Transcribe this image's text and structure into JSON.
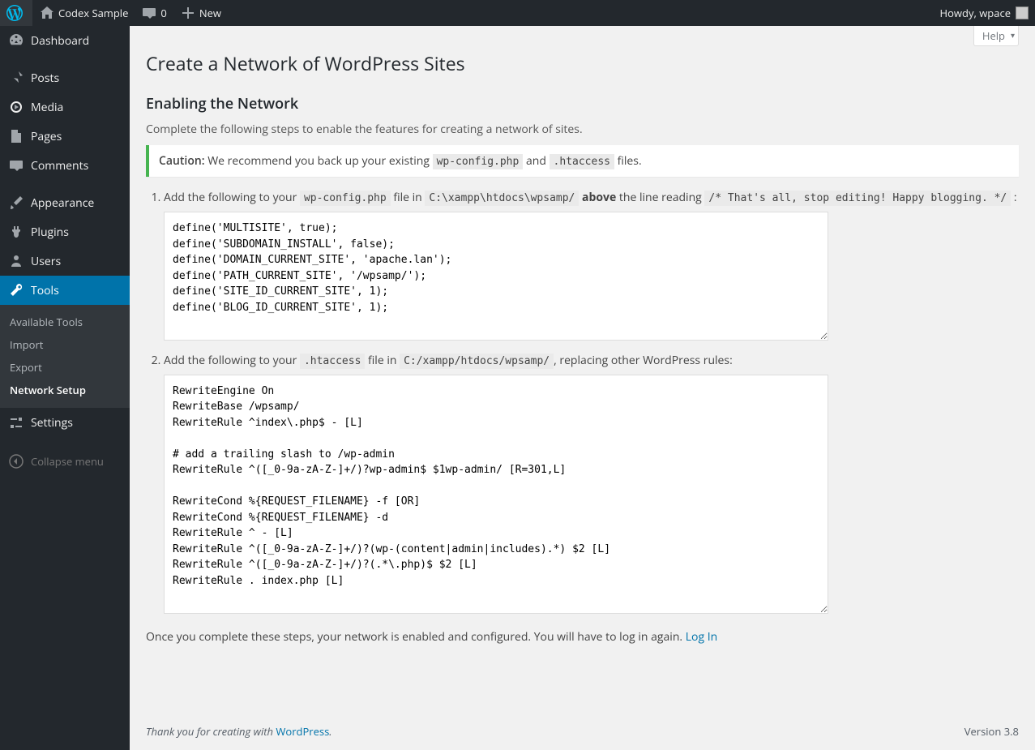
{
  "toolbar": {
    "site_name": "Codex Sample",
    "comments_count": "0",
    "new_label": "New",
    "howdy": "Howdy, wpace"
  },
  "sidebar": {
    "items": [
      {
        "label": "Dashboard"
      },
      {
        "label": "Posts"
      },
      {
        "label": "Media"
      },
      {
        "label": "Pages"
      },
      {
        "label": "Comments"
      },
      {
        "label": "Appearance"
      },
      {
        "label": "Plugins"
      },
      {
        "label": "Users"
      },
      {
        "label": "Tools"
      },
      {
        "label": "Settings"
      }
    ],
    "tools_submenu": [
      {
        "label": "Available Tools"
      },
      {
        "label": "Import"
      },
      {
        "label": "Export"
      },
      {
        "label": "Network Setup"
      }
    ],
    "collapse": "Collapse menu"
  },
  "help_tab": "Help",
  "page": {
    "title": "Create a Network of WordPress Sites",
    "subhead": "Enabling the Network",
    "intro": "Complete the following steps to enable the features for creating a network of sites.",
    "caution_label": "Caution:",
    "caution_pre": " We recommend you back up your existing ",
    "caution_file1": "wp-config.php",
    "caution_and": " and ",
    "caution_file2": ".htaccess",
    "caution_post": " files.",
    "step1_pre": "Add the following to your ",
    "step1_file": "wp-config.php",
    "step1_mid": " file in ",
    "step1_path": "C:\\xampp\\htdocs\\wpsamp/",
    "step1_above": "above",
    "step1_after": " the line reading ",
    "step1_line": "/* That's all, stop editing! Happy blogging. */",
    "step1_colon": " :",
    "code1": "define('MULTISITE', true);\ndefine('SUBDOMAIN_INSTALL', false);\ndefine('DOMAIN_CURRENT_SITE', 'apache.lan');\ndefine('PATH_CURRENT_SITE', '/wpsamp/');\ndefine('SITE_ID_CURRENT_SITE', 1);\ndefine('BLOG_ID_CURRENT_SITE', 1);",
    "step2_pre": "Add the following to your ",
    "step2_file": ".htaccess",
    "step2_mid": " file in ",
    "step2_path": "C:/xampp/htdocs/wpsamp/",
    "step2_after": ", replacing other WordPress rules:",
    "code2": "RewriteEngine On\nRewriteBase /wpsamp/\nRewriteRule ^index\\.php$ - [L]\n\n# add a trailing slash to /wp-admin\nRewriteRule ^([_0-9a-zA-Z-]+/)?wp-admin$ $1wp-admin/ [R=301,L]\n\nRewriteCond %{REQUEST_FILENAME} -f [OR]\nRewriteCond %{REQUEST_FILENAME} -d\nRewriteRule ^ - [L]\nRewriteRule ^([_0-9a-zA-Z-]+/)?(wp-(content|admin|includes).*) $2 [L]\nRewriteRule ^([_0-9a-zA-Z-]+/)?(.*\\.php)$ $2 [L]\nRewriteRule . index.php [L]",
    "final_pre": "Once you complete these steps, your network is enabled and configured. You will have to log in again. ",
    "login_link": "Log In"
  },
  "footer": {
    "thanks_pre": "Thank you for creating with ",
    "wp": "WordPress",
    "thanks_post": ".",
    "version": "Version 3.8"
  }
}
